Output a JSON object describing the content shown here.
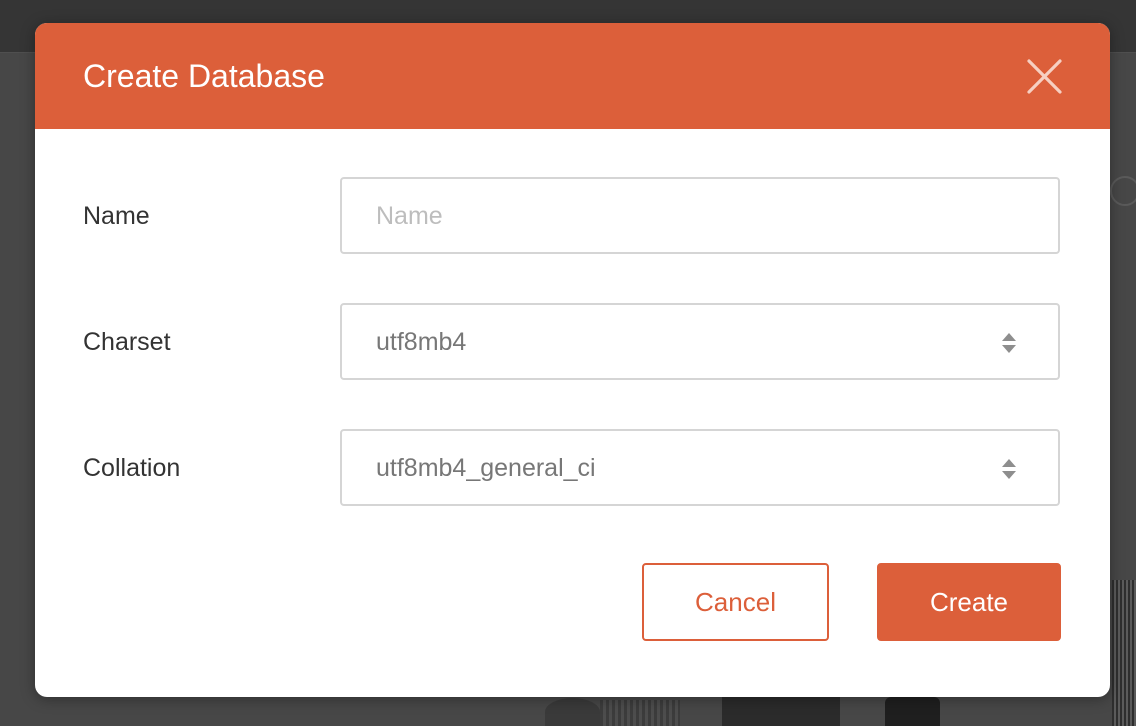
{
  "dialog": {
    "title": "Create Database",
    "accent_color": "#dc5f3a",
    "close_icon": "close-icon"
  },
  "form": {
    "name": {
      "label": "Name",
      "value": "",
      "placeholder": "Name"
    },
    "charset": {
      "label": "Charset",
      "selected": "utf8mb4",
      "icon": "select-arrows-icon"
    },
    "collation": {
      "label": "Collation",
      "selected": "utf8mb4_general_ci",
      "icon": "select-arrows-icon"
    }
  },
  "actions": {
    "cancel_label": "Cancel",
    "create_label": "Create"
  }
}
